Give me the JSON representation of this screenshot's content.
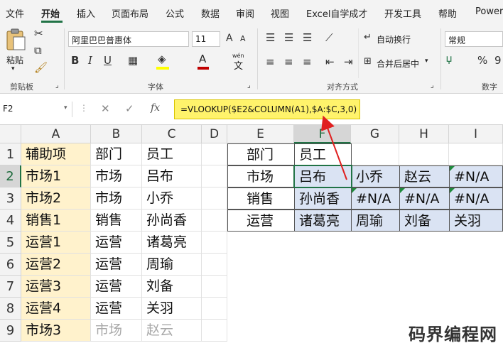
{
  "menu": {
    "tabs": [
      "文件",
      "开始",
      "插入",
      "页面布局",
      "公式",
      "数据",
      "审阅",
      "视图",
      "Excel自学成才",
      "开发工具",
      "帮助",
      "Power"
    ],
    "active": "开始"
  },
  "ribbon": {
    "clipboard": {
      "paste_label": "粘贴",
      "group_label": "剪贴板"
    },
    "font": {
      "font_name": "阿里巴巴普惠体",
      "font_size": "11",
      "group_label": "字体",
      "bold": "B",
      "italic": "I",
      "underline": "U",
      "grow": "A",
      "shrink": "A",
      "wen_label": "wén",
      "wen_char": "文"
    },
    "alignment": {
      "wrap_label": "自动换行",
      "merge_label": "合并后居中",
      "group_label": "对齐方式"
    },
    "number": {
      "format": "常规",
      "percent": "%",
      "comma": "9",
      "group_label": "数字"
    },
    "colors": {
      "accent": "#217346",
      "font_color": "#c00000",
      "fill_color": "#ffff00",
      "formula_highlight": "#fff36b",
      "helper_fill": "#fff2cc",
      "result_fill": "#dae3f3",
      "error_marker": "#1e8a3c"
    }
  },
  "formula_bar": {
    "name_box": "F2",
    "cancel": "✕",
    "enter": "✓",
    "fx": "fx",
    "formula": "=VLOOKUP($E2&COLUMN(A1),$A:$C,3,0)"
  },
  "columns": [
    "A",
    "B",
    "C",
    "D",
    "E",
    "F",
    "G",
    "H",
    "I"
  ],
  "rows": [
    "1",
    "2",
    "3",
    "4",
    "5",
    "6",
    "7",
    "8",
    "9"
  ],
  "cells": {
    "A": [
      "辅助项",
      "市场1",
      "市场2",
      "销售1",
      "运营1",
      "运营2",
      "运营3",
      "运营4",
      "市场3"
    ],
    "B": [
      "部门",
      "市场",
      "市场",
      "销售",
      "运营",
      "运营",
      "运营",
      "运营",
      "市场"
    ],
    "C": [
      "员工",
      "吕布",
      "小乔",
      "孙尚香",
      "诸葛亮",
      "周瑜",
      "刘备",
      "关羽",
      "赵云"
    ],
    "E": [
      "部门",
      "市场",
      "销售",
      "运营"
    ],
    "F": [
      "员工",
      "吕布",
      "孙尚香",
      "诸葛亮"
    ],
    "G": [
      "",
      "小乔",
      "#N/A",
      "周瑜"
    ],
    "H": [
      "",
      "赵云",
      "#N/A",
      "刘备"
    ],
    "I": [
      "",
      "#N/A",
      "#N/A",
      "关羽"
    ]
  },
  "watermark": "码界编程网"
}
